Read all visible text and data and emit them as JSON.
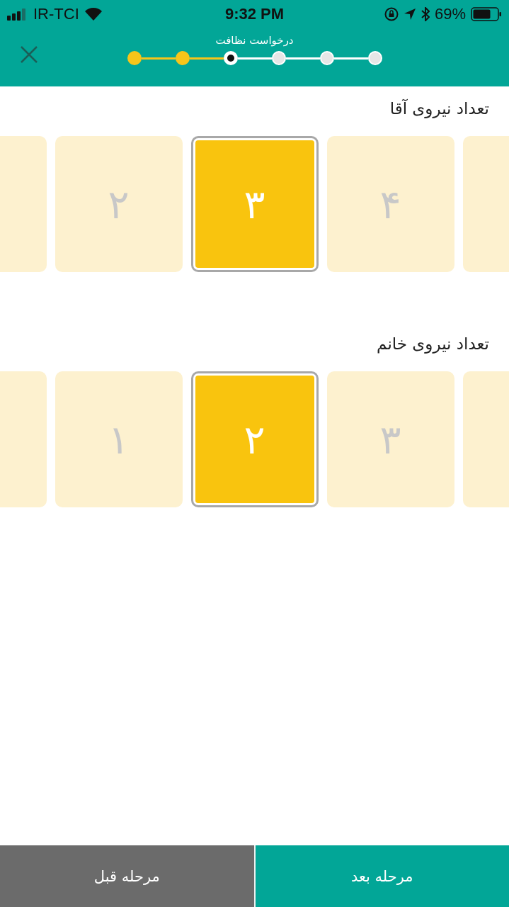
{
  "status_bar": {
    "carrier": "IR-TCI",
    "time": "9:32 PM",
    "battery": "69%"
  },
  "header": {
    "title": "درخواست نظافت",
    "steps": [
      {
        "kind": "done"
      },
      {
        "kind": "done"
      },
      {
        "kind": "current"
      },
      {
        "kind": "todo"
      },
      {
        "kind": "todo"
      },
      {
        "kind": "todo"
      }
    ]
  },
  "pickers": [
    {
      "label": "تعداد نیروی آقا",
      "options": [
        {
          "value": "۴",
          "selected": false
        },
        {
          "value": "۳",
          "selected": true
        },
        {
          "value": "۲",
          "selected": false
        }
      ]
    },
    {
      "label": "تعداد نیروی خانم",
      "options": [
        {
          "value": "۳",
          "selected": false
        },
        {
          "value": "۲",
          "selected": true
        },
        {
          "value": "۱",
          "selected": false
        }
      ]
    }
  ],
  "footer": {
    "previous": "مرحله قبل",
    "next": "مرحله بعد"
  }
}
